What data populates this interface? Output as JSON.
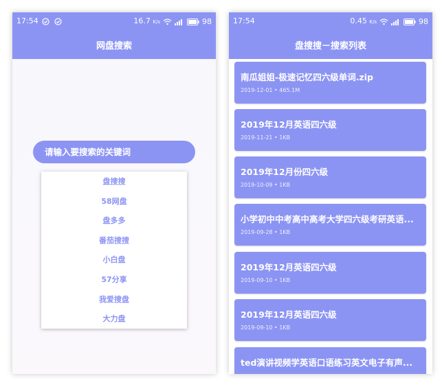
{
  "left_screen": {
    "status": {
      "time": "17:54",
      "speed": "16.7",
      "speed_unit": "K/s",
      "battery": "98"
    },
    "title": "网盘搜索",
    "search": {
      "placeholder": "请输入要搜索的关键词"
    },
    "dropdown_items": [
      "盘搜搜",
      "58网盘",
      "盘多多",
      "番茄搜搜",
      "小白盘",
      "57分享",
      "我爱搜盘",
      "大力盘"
    ]
  },
  "right_screen": {
    "status": {
      "time": "17:54",
      "speed": "0.45",
      "speed_unit": "K/s",
      "battery": "98"
    },
    "title": "盘搜搜－搜索列表",
    "results": [
      {
        "title": "南瓜姐姐-极速记忆四六级单词.zip",
        "meta": "2019-12-01 • 465.1M"
      },
      {
        "title": "2019年12月英语四六级",
        "meta": "2019-11-21 • 1KB"
      },
      {
        "title": "2019年12月份四六级",
        "meta": "2019-10-09 • 1KB"
      },
      {
        "title": "小学初中中考高中高考大学四六级考研英语...",
        "meta": "2019-09-28 • 1KB"
      },
      {
        "title": "2019年12月英语四六级",
        "meta": "2019-09-10 • 1KB"
      },
      {
        "title": "2019年12月英语四六级",
        "meta": "2019-09-10 • 1KB"
      },
      {
        "title": "ted演讲视频学英语口语练习英文电子有声...",
        "meta": ""
      }
    ]
  },
  "colors": {
    "accent": "#8c94f3",
    "background": "#f7f7fb"
  }
}
